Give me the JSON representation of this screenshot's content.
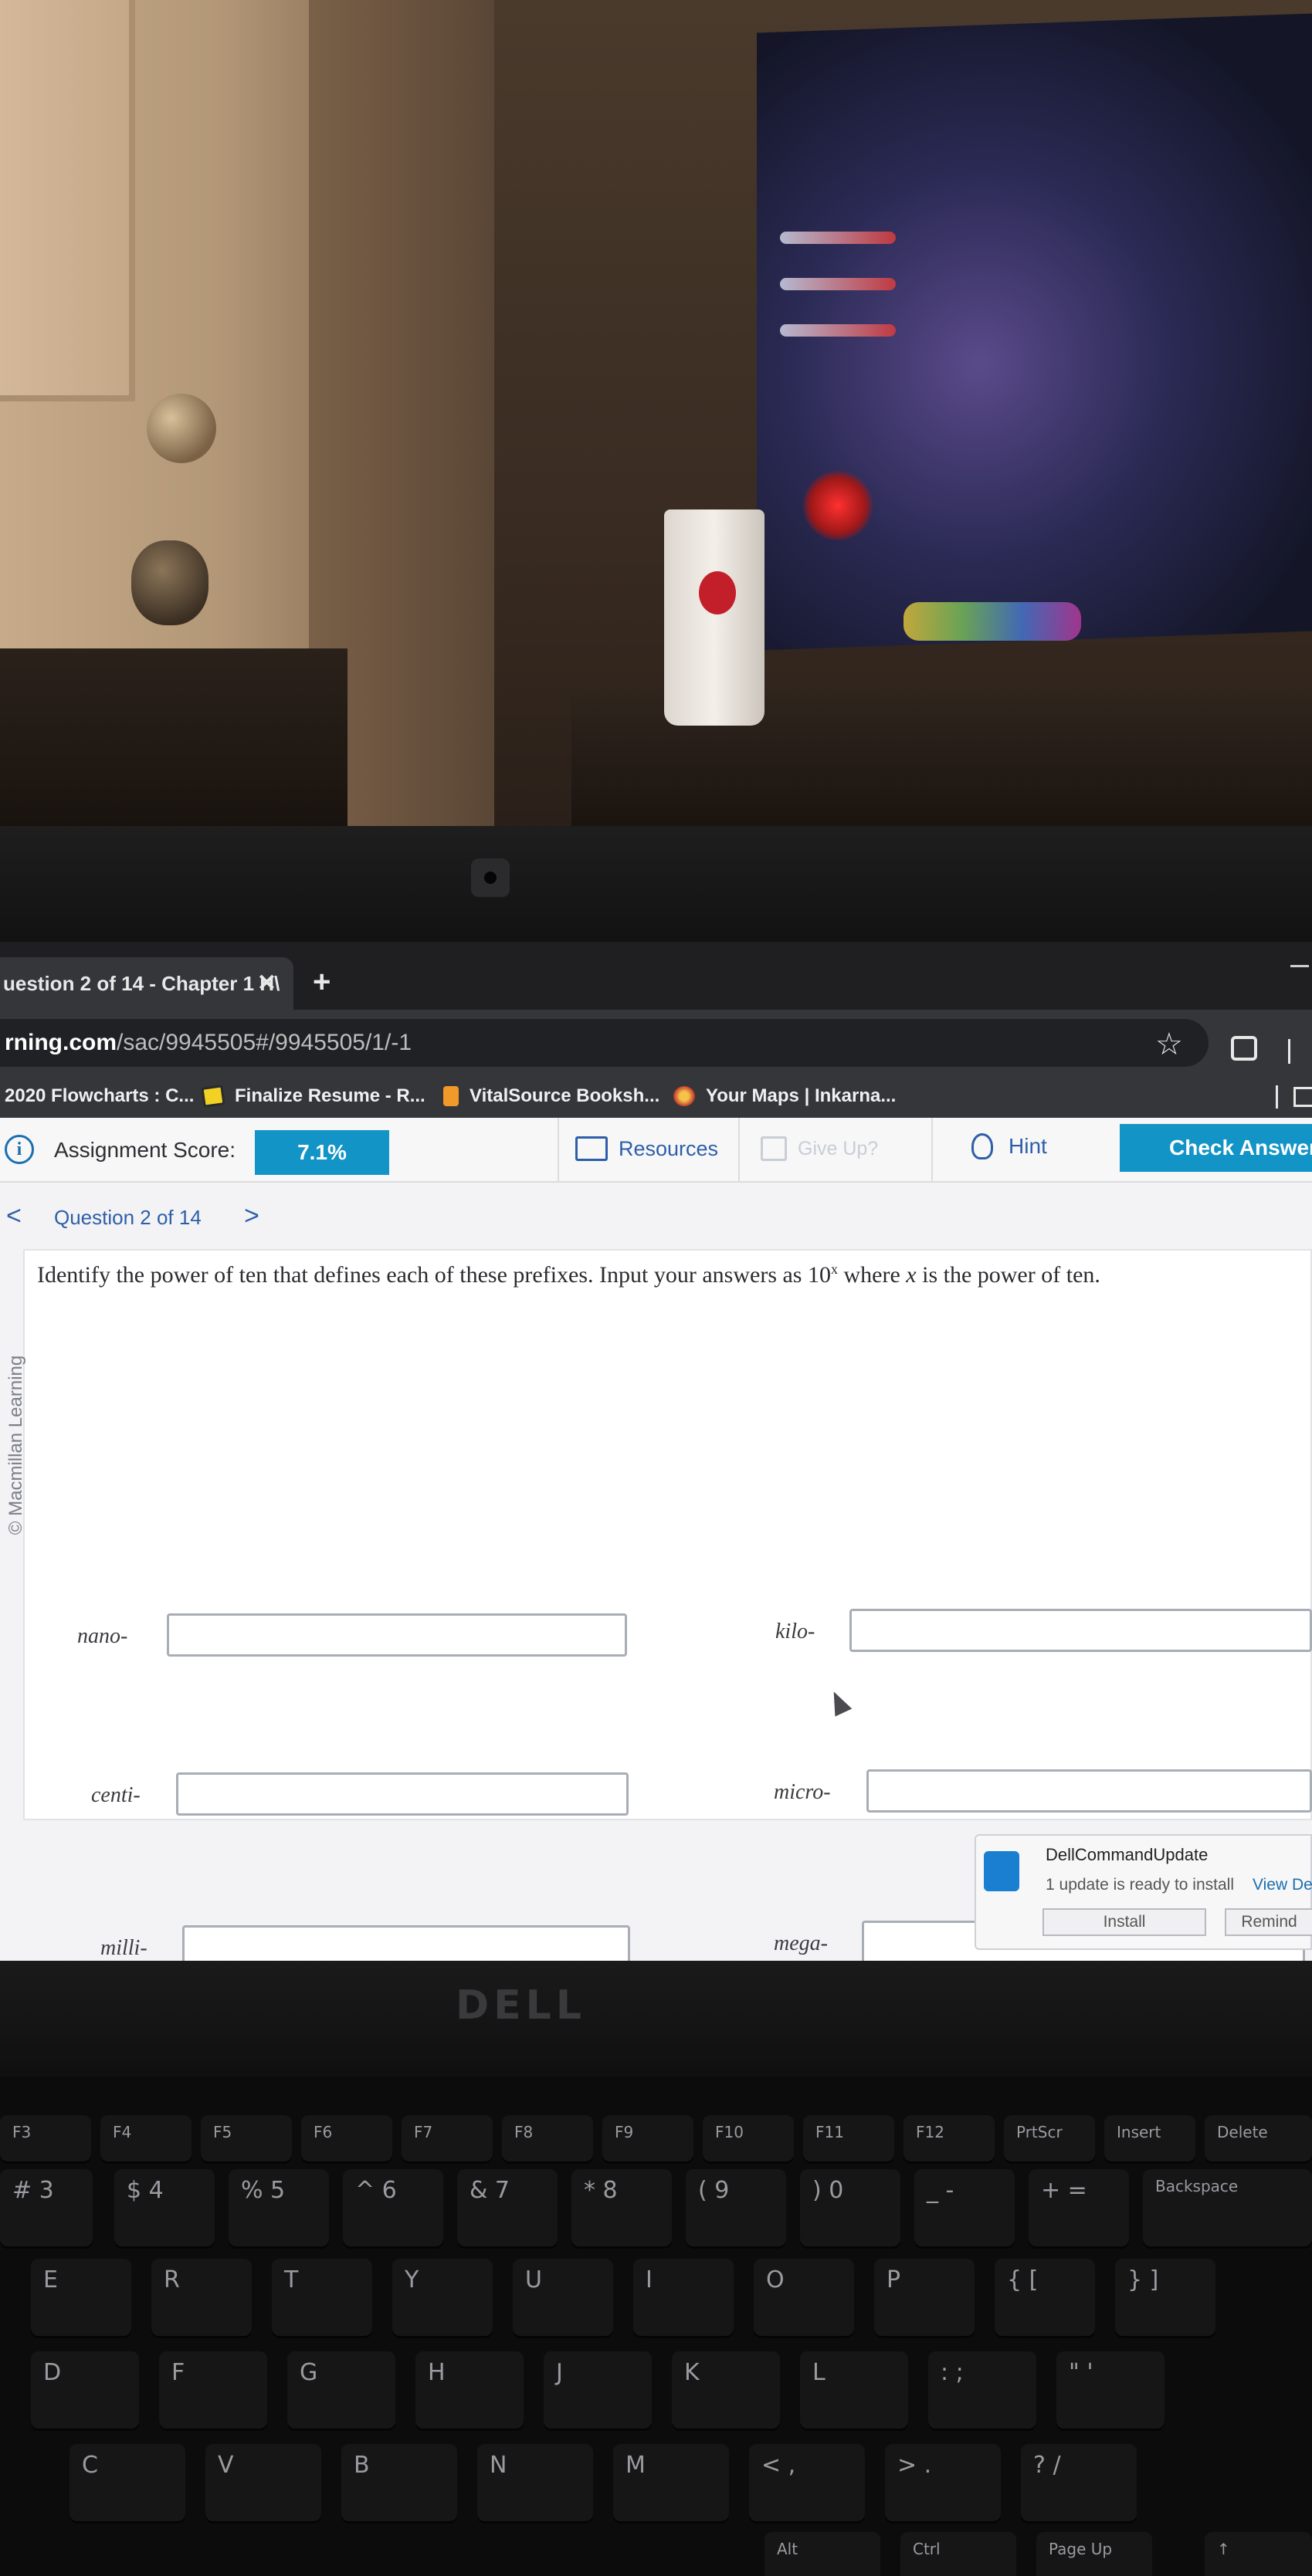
{
  "browser": {
    "tab_title": "uestion 2 of 14 - Chapter 1 H\\",
    "tab_close": "✕",
    "new_tab": "+",
    "url_host": "rning.com",
    "url_path": "/sac/9945505#/9945505/1/-1",
    "bookmarks": [
      {
        "label": "2020 Flowcharts : C...",
        "icon": "none"
      },
      {
        "label": "Finalize Resume - R...",
        "icon": "folder-icon"
      },
      {
        "label": "VitalSource Booksh...",
        "icon": "book-icon"
      },
      {
        "label": "Your Maps | Inkarna...",
        "icon": "maps-icon"
      }
    ]
  },
  "header": {
    "info": "i",
    "score_label": "Assignment Score:",
    "score_value": "7.1%",
    "resources": "Resources",
    "give_up": "Give Up?",
    "hint": "Hint",
    "check_answer": "Check Answer"
  },
  "question_nav": {
    "prev": "<",
    "label": "Question 2 of 14",
    "next": ">"
  },
  "question": {
    "watermark": "© Macmillan Learning",
    "text_before": "Identify the power of ten that defines each of these prefixes. Input your answers as 10",
    "exponent": "x",
    "text_where": " where ",
    "variable": "x",
    "text_after": " is the power of ten.",
    "fields": [
      {
        "label": "nano-",
        "value": ""
      },
      {
        "label": "kilo-",
        "value": ""
      },
      {
        "label": "centi-",
        "value": ""
      },
      {
        "label": "micro-",
        "value": ""
      },
      {
        "label": "milli-",
        "value": ""
      },
      {
        "label": "mega-",
        "value": ""
      }
    ]
  },
  "notification": {
    "title": "DellCommandUpdate",
    "message": "1 update is ready to install",
    "link": "View De",
    "install": "Install",
    "remind": "Remind"
  },
  "laptop": {
    "brand": "DELL",
    "keys": {
      "f3": "F3",
      "f4": "F4",
      "f5": "F5",
      "f6": "F6",
      "f7": "F7",
      "f8": "F8",
      "f9": "F9",
      "f10": "F10",
      "f11": "F11",
      "f12": "F12",
      "prtscr": "PrtScr",
      "insert": "Insert",
      "delete": "Delete",
      "n3": "# 3",
      "n4": "$ 4",
      "n5": "% 5",
      "n6": "^ 6",
      "n7": "& 7",
      "n8": "* 8",
      "n9": "( 9",
      "n0": ") 0",
      "minus": "_ -",
      "plus": "+ =",
      "backspace": "Backspace",
      "e": "E",
      "r": "R",
      "t": "T",
      "y": "Y",
      "u": "U",
      "i": "I",
      "o": "O",
      "p": "P",
      "lbrace": "{ [",
      "rbrace": "} ]",
      "d": "D",
      "f": "F",
      "g": "G",
      "h": "H",
      "j": "J",
      "k": "K",
      "l": "L",
      "semicolon": ": ;",
      "quote": "\" '",
      "c": "C",
      "v": "V",
      "b": "B",
      "n": "N",
      "m": "M",
      "comma": "< ,",
      "period": "> .",
      "slash": "? /",
      "alt": "Alt",
      "ctrl": "Ctrl",
      "pageup": "Page Up",
      "uparrow": "↑"
    }
  }
}
